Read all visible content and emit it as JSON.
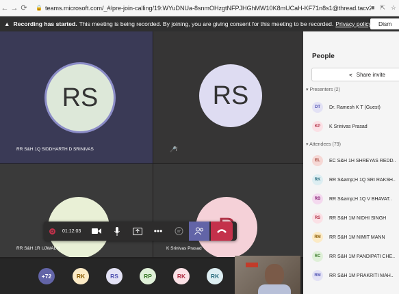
{
  "browser": {
    "url": "teams.microsoft.com/_#/pre-join-calling/19:WYuDNUa-8snmOHzgtNFPJHGhMW10K8mUCaH-KF71n8s1@thread.tacv2"
  },
  "banner": {
    "bold": "Recording has started.",
    "text": "This meeting is being recorded. By joining, you are giving consent for this meeting to be recorded.",
    "link": "Privacy policy",
    "dismiss": "Dism"
  },
  "tiles": [
    {
      "initials": "RS",
      "name": "RR S&H 1Q SIDDHARTH D SRINIVAS"
    },
    {
      "initials": "RS",
      "name": ""
    },
    {
      "initials": "",
      "name": "RR S&H 1R UJWAL K"
    },
    {
      "initials": "P",
      "name": "K Srinivas Prasad"
    }
  ],
  "controls": {
    "timer": "01:12:03"
  },
  "chips": [
    {
      "label": "+72",
      "bg": "#6264a7",
      "fg": "#ffffff"
    },
    {
      "label": "RK",
      "bg": "#fcebc6",
      "fg": "#8a5a00"
    },
    {
      "label": "RS",
      "bg": "#e3e2f5",
      "fg": "#4f52b2"
    },
    {
      "label": "RP",
      "bg": "#dff0d8",
      "fg": "#3b7a2a"
    },
    {
      "label": "RK",
      "bg": "#fbe1e6",
      "fg": "#b03045"
    },
    {
      "label": "RK",
      "bg": "#ddeef2",
      "fg": "#2c6f80"
    }
  ],
  "people": {
    "title": "People",
    "share": "Share invite",
    "presenters_label": "Presenters (2)",
    "attendees_label": "Attendees (79)",
    "presenters": [
      {
        "initials": "DT",
        "name": "Dr. Ramesh K T (Guest)",
        "bg": "#e3e2f5",
        "fg": "#4f52b2"
      },
      {
        "initials": "KP",
        "name": "K Srinivas Prasad",
        "bg": "#fbe1e6",
        "fg": "#b03045"
      }
    ],
    "attendees": [
      {
        "initials": "EL",
        "name": "EC S&H 1H SHREYAS REDD..",
        "bg": "#f6d8d5",
        "fg": "#9c3a2e"
      },
      {
        "initials": "RK",
        "name": "RR S&amp;H 1Q SRI RAKSH..",
        "bg": "#ddeef2",
        "fg": "#2c6f80"
      },
      {
        "initials": "RB",
        "name": "RR S&amp;H 1Q V BHAVAT..",
        "bg": "#f4d9ef",
        "fg": "#8a2a7a"
      },
      {
        "initials": "RS",
        "name": "RR S&H 1M NIDHI SINGH",
        "bg": "#fbe1e6",
        "fg": "#b03045"
      },
      {
        "initials": "RM",
        "name": "RR S&H 1M NIMIT MANN",
        "bg": "#fcebc6",
        "fg": "#8a5a00"
      },
      {
        "initials": "RC",
        "name": "RR S&H 1M PANDIPATI CHE..",
        "bg": "#dff0d8",
        "fg": "#3b7a2a"
      },
      {
        "initials": "RM",
        "name": "RR S&H 1M PRAKRITI MAH..",
        "bg": "#e3e2f5",
        "fg": "#4f52b2"
      }
    ]
  }
}
